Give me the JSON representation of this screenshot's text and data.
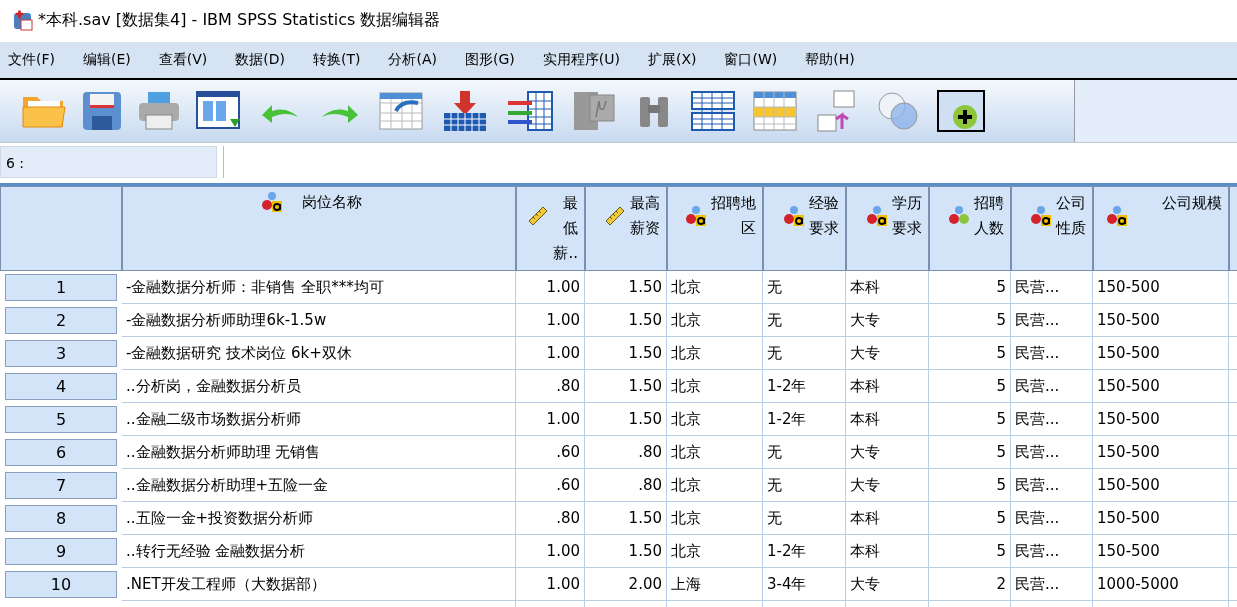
{
  "window": {
    "title": "*本科.sav [数据集4] - IBM SPSS Statistics 数据编辑器"
  },
  "menu": [
    "文件(F)",
    "编辑(E)",
    "查看(V)",
    "数据(D)",
    "转换(T)",
    "分析(A)",
    "图形(G)",
    "实用程序(U)",
    "扩展(X)",
    "窗口(W)",
    "帮助(H)"
  ],
  "cell_reference": "6 :",
  "table": {
    "columns": [
      {
        "label": "岗位名称",
        "kind": "string"
      },
      {
        "label": "最低薪..",
        "kind": "scale"
      },
      {
        "label": "最高薪资",
        "kind": "scale"
      },
      {
        "label": "招聘地区",
        "kind": "string"
      },
      {
        "label": "经验要求",
        "kind": "string"
      },
      {
        "label": "学历要求",
        "kind": "string"
      },
      {
        "label": "招聘人数",
        "kind": "nominal"
      },
      {
        "label": "公司性质",
        "kind": "string"
      },
      {
        "label": "公司规模",
        "kind": "string"
      }
    ],
    "rows": [
      {
        "number": "1",
        "cells": [
          "-金融数据分析师：非销售 全职***均可",
          "1.00",
          "1.50",
          "北京",
          "无",
          "本科",
          "5",
          "民营...",
          "150-500"
        ]
      },
      {
        "number": "2",
        "cells": [
          "-金融数据分析师助理6k-1.5w",
          "1.00",
          "1.50",
          "北京",
          "无",
          "大专",
          "5",
          "民营...",
          "150-500"
        ]
      },
      {
        "number": "3",
        "cells": [
          "-金融数据研究 技术岗位 6k+双休",
          "1.00",
          "1.50",
          "北京",
          "无",
          "大专",
          "5",
          "民营...",
          "150-500"
        ]
      },
      {
        "number": "4",
        "cells": [
          "..分析岗，金融数据分析员",
          ".80",
          "1.50",
          "北京",
          "1-2年",
          "本科",
          "5",
          "民营...",
          "150-500"
        ]
      },
      {
        "number": "5",
        "cells": [
          "..金融二级市场数据分析师",
          "1.00",
          "1.50",
          "北京",
          "1-2年",
          "本科",
          "5",
          "民营...",
          "150-500"
        ]
      },
      {
        "number": "6",
        "cells": [
          "..金融数据分析师助理 无销售",
          ".60",
          ".80",
          "北京",
          "无",
          "大专",
          "5",
          "民营...",
          "150-500"
        ]
      },
      {
        "number": "7",
        "cells": [
          "..金融数据分析助理+五险一金",
          ".60",
          ".80",
          "北京",
          "无",
          "大专",
          "5",
          "民营...",
          "150-500"
        ]
      },
      {
        "number": "8",
        "cells": [
          "..五险一金+投资数据分析师",
          ".80",
          "1.50",
          "北京",
          "无",
          "本科",
          "5",
          "民营...",
          "150-500"
        ]
      },
      {
        "number": "9",
        "cells": [
          "..转行无经验 金融数据分析",
          "1.00",
          "1.50",
          "北京",
          "1-2年",
          "本科",
          "5",
          "民营...",
          "150-500"
        ]
      },
      {
        "number": "10",
        "cells": [
          ".NET开发工程师（大数据部）",
          "1.00",
          "2.00",
          "上海",
          "3-4年",
          "大专",
          "2",
          "民营...",
          "1000-5000"
        ]
      }
    ]
  }
}
